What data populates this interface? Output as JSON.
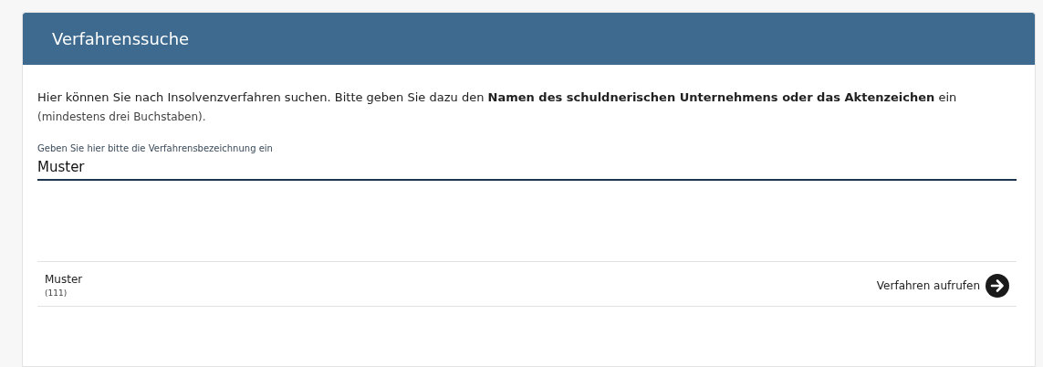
{
  "panel": {
    "title": "Verfahrenssuche"
  },
  "intro": {
    "text": "Hier können Sie nach Insolvenzverfahren suchen. Bitte geben Sie dazu den **Namen des schuldnerischen Unternehmens oder das Aktenzeichen** ein",
    "note": "(mindestens drei Buchstaben)."
  },
  "search": {
    "label": "Geben Sie hier bitte die Verfahrensbezeichnung ein",
    "value": "Muster"
  },
  "results": [
    {
      "name": "Muster",
      "number": "(111)",
      "action": "Verfahren aufrufen"
    }
  ]
}
